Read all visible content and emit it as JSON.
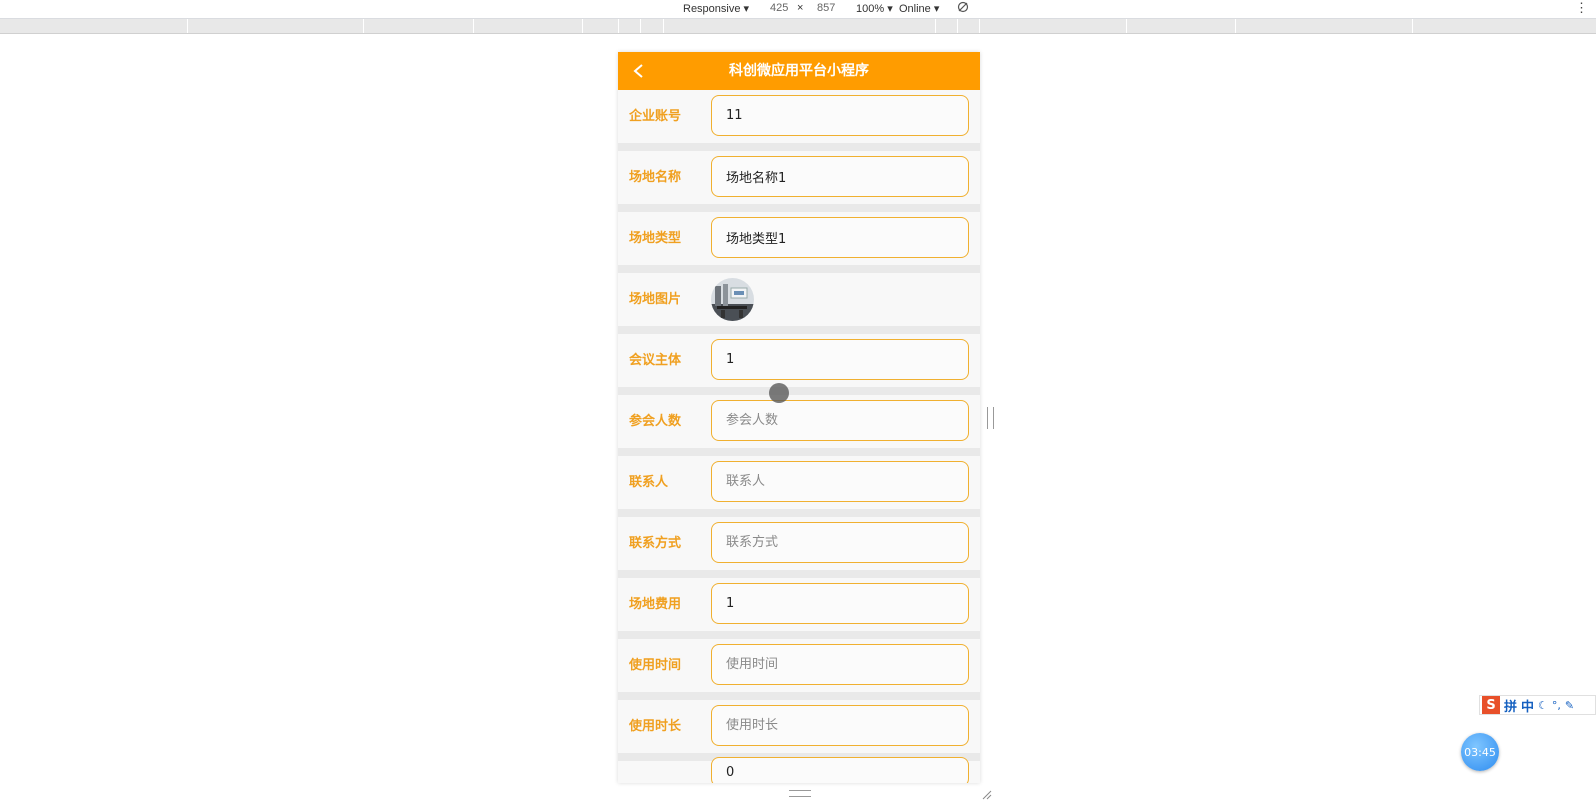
{
  "devtools": {
    "device": "Responsive",
    "width": "425",
    "times": "×",
    "height": "857",
    "zoom": "100%",
    "network": "Online",
    "more_icon": "kebab-menu-icon",
    "rotate_icon": "rotate-icon"
  },
  "app": {
    "title": "科创微应用平台小程序",
    "accent_color": "#ff9c00",
    "label_color": "#f0a020",
    "back_icon": "chevron-left-icon"
  },
  "form": {
    "fields": [
      {
        "label": "企业账号",
        "value": "11",
        "placeholder": ""
      },
      {
        "label": "场地名称",
        "value": "场地名称1",
        "placeholder": ""
      },
      {
        "label": "场地类型",
        "value": "场地类型1",
        "placeholder": ""
      },
      {
        "label": "场地图片",
        "type": "image"
      },
      {
        "label": "会议主体",
        "value": "1",
        "placeholder": ""
      },
      {
        "label": "参会人数",
        "value": "",
        "placeholder": "参会人数"
      },
      {
        "label": "联系人",
        "value": "",
        "placeholder": "联系人"
      },
      {
        "label": "联系方式",
        "value": "",
        "placeholder": "联系方式"
      },
      {
        "label": "场地费用",
        "value": "1",
        "placeholder": ""
      },
      {
        "label": "使用时间",
        "value": "",
        "placeholder": "使用时间"
      },
      {
        "label": "使用时长",
        "value": "",
        "placeholder": "使用时长"
      },
      {
        "label": "",
        "value": "0",
        "placeholder": ""
      }
    ]
  },
  "ime": {
    "logo": "S",
    "mode": "拼",
    "lang": "中"
  },
  "timer": {
    "text": "03:45"
  }
}
